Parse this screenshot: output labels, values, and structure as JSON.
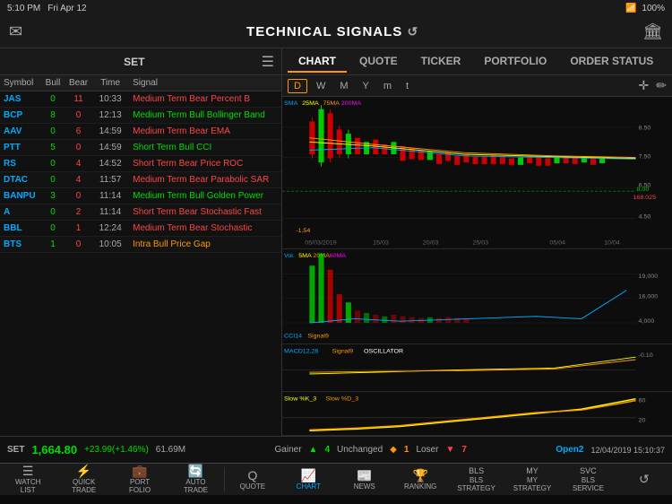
{
  "statusBar": {
    "time": "5:10 PM",
    "date": "Fri Apr 12",
    "wifi": "WiFi",
    "battery": "100%"
  },
  "header": {
    "title": "TECHNICAL SIGNALS",
    "leftIcon": "✉",
    "rightIcon": "🏛"
  },
  "leftPanel": {
    "setLabel": "SET",
    "tableHeaders": [
      "Symbol",
      "Bull",
      "Bear",
      "Time",
      "Signal"
    ],
    "rows": [
      {
        "symbol": "JAS",
        "bull": 0,
        "bear": 11,
        "time": "10:33",
        "signal": "Medium Term Bear Percent B",
        "type": "bear"
      },
      {
        "symbol": "BCP",
        "bull": 8,
        "bear": 0,
        "time": "12:13",
        "signal": "Medium Term Bull Bollinger Band",
        "type": "bull"
      },
      {
        "symbol": "AAV",
        "bull": 0,
        "bear": 6,
        "time": "14:59",
        "signal": "Medium Term Bear EMA",
        "type": "bear"
      },
      {
        "symbol": "PTT",
        "bull": 5,
        "bear": 0,
        "time": "14:59",
        "signal": "Short Term Bull CCI",
        "type": "bull"
      },
      {
        "symbol": "RS",
        "bull": 0,
        "bear": 4,
        "time": "14:52",
        "signal": "Short Term Bear Price ROC",
        "type": "bear"
      },
      {
        "symbol": "DTAC",
        "bull": 0,
        "bear": 4,
        "time": "11:57",
        "signal": "Medium Term Bear Parabolic SAR",
        "type": "bear"
      },
      {
        "symbol": "BANPU",
        "bull": 3,
        "bear": 0,
        "time": "11:14",
        "signal": "Medium Term Bull Golden Power",
        "type": "bull"
      },
      {
        "symbol": "A",
        "bull": 0,
        "bear": 2,
        "time": "11:14",
        "signal": "Short Term Bear Stochastic Fast",
        "type": "bear"
      },
      {
        "symbol": "BBL",
        "bull": 0,
        "bear": 1,
        "time": "12:24",
        "signal": "Medium Term Bear Stochastic",
        "type": "bear"
      },
      {
        "symbol": "BTS",
        "bull": 1,
        "bear": 0,
        "time": "10:05",
        "signal": "Intra Bull Price Gap",
        "type": "intra"
      }
    ]
  },
  "tabs": [
    {
      "label": "CHART",
      "active": true
    },
    {
      "label": "QUOTE",
      "active": false
    },
    {
      "label": "TICKER",
      "active": false
    },
    {
      "label": "PORTFOLIO",
      "active": false
    },
    {
      "label": "ORDER STATUS",
      "active": false
    }
  ],
  "chartSubTabs": [
    {
      "label": "D",
      "active": true
    },
    {
      "label": "W",
      "active": false
    },
    {
      "label": "M",
      "active": false
    },
    {
      "label": "Y",
      "active": false
    },
    {
      "label": "m",
      "active": false
    },
    {
      "label": "t",
      "active": false
    }
  ],
  "chartLabels": {
    "sma": "SMA 25MA 75MA 200MA",
    "volumeIndicator": "Vol. 5MA 20MA 60MA",
    "cci": "CCI14 Signal9",
    "macd": "MACD12,26 Signal9 OSCILLATOR",
    "stoch": "Slow %K_3 Slow %D_3"
  },
  "chartDates": [
    "05/03/2019",
    "15/03",
    "20/03",
    "25/03",
    "05/04",
    "10/04"
  ],
  "priceLabels": {
    "high": "8.50",
    "mid1": "7.50",
    "mid2": "6.50",
    "current": "8.00",
    "special": "168.025",
    "low": "4.50"
  },
  "bottomStatus": {
    "setName": "SET",
    "price": "1,664.80",
    "change": "+23.99(+1.46%)",
    "volume": "61.69M",
    "gainerLabel": "Gainer",
    "gainerValue": "4",
    "unchangedLabel": "Unchanged",
    "unchangedValue": "1",
    "loserLabel": "Loser",
    "loserValue": "7",
    "openLabel": "Open2",
    "datetime": "12/04/2019 15:10:37"
  },
  "bottomNav": [
    {
      "label": "WATCH\nLIST",
      "icon": "☰",
      "active": false
    },
    {
      "label": "QUICK\nTRADE",
      "icon": "⚡",
      "active": false
    },
    {
      "label": "PORT\nFOLIO",
      "icon": "💼",
      "active": false
    },
    {
      "label": "AUTO\nTRADE",
      "icon": "🤖",
      "active": false
    },
    {
      "label": "QUOTE",
      "icon": "Q",
      "active": false
    },
    {
      "label": "CHART",
      "icon": "📈",
      "active": true
    },
    {
      "label": "NEWS",
      "icon": "📰",
      "active": false
    },
    {
      "label": "RANKING",
      "icon": "🏆",
      "active": false
    },
    {
      "label": "BLS\nSTRATEGY",
      "icon": "B",
      "active": false
    },
    {
      "label": "MY\nSTRATEGY",
      "icon": "M",
      "active": false
    },
    {
      "label": "BLS\nSERVICE",
      "icon": "S",
      "active": false
    },
    {
      "label": "↺",
      "icon": "↺",
      "active": false
    }
  ]
}
